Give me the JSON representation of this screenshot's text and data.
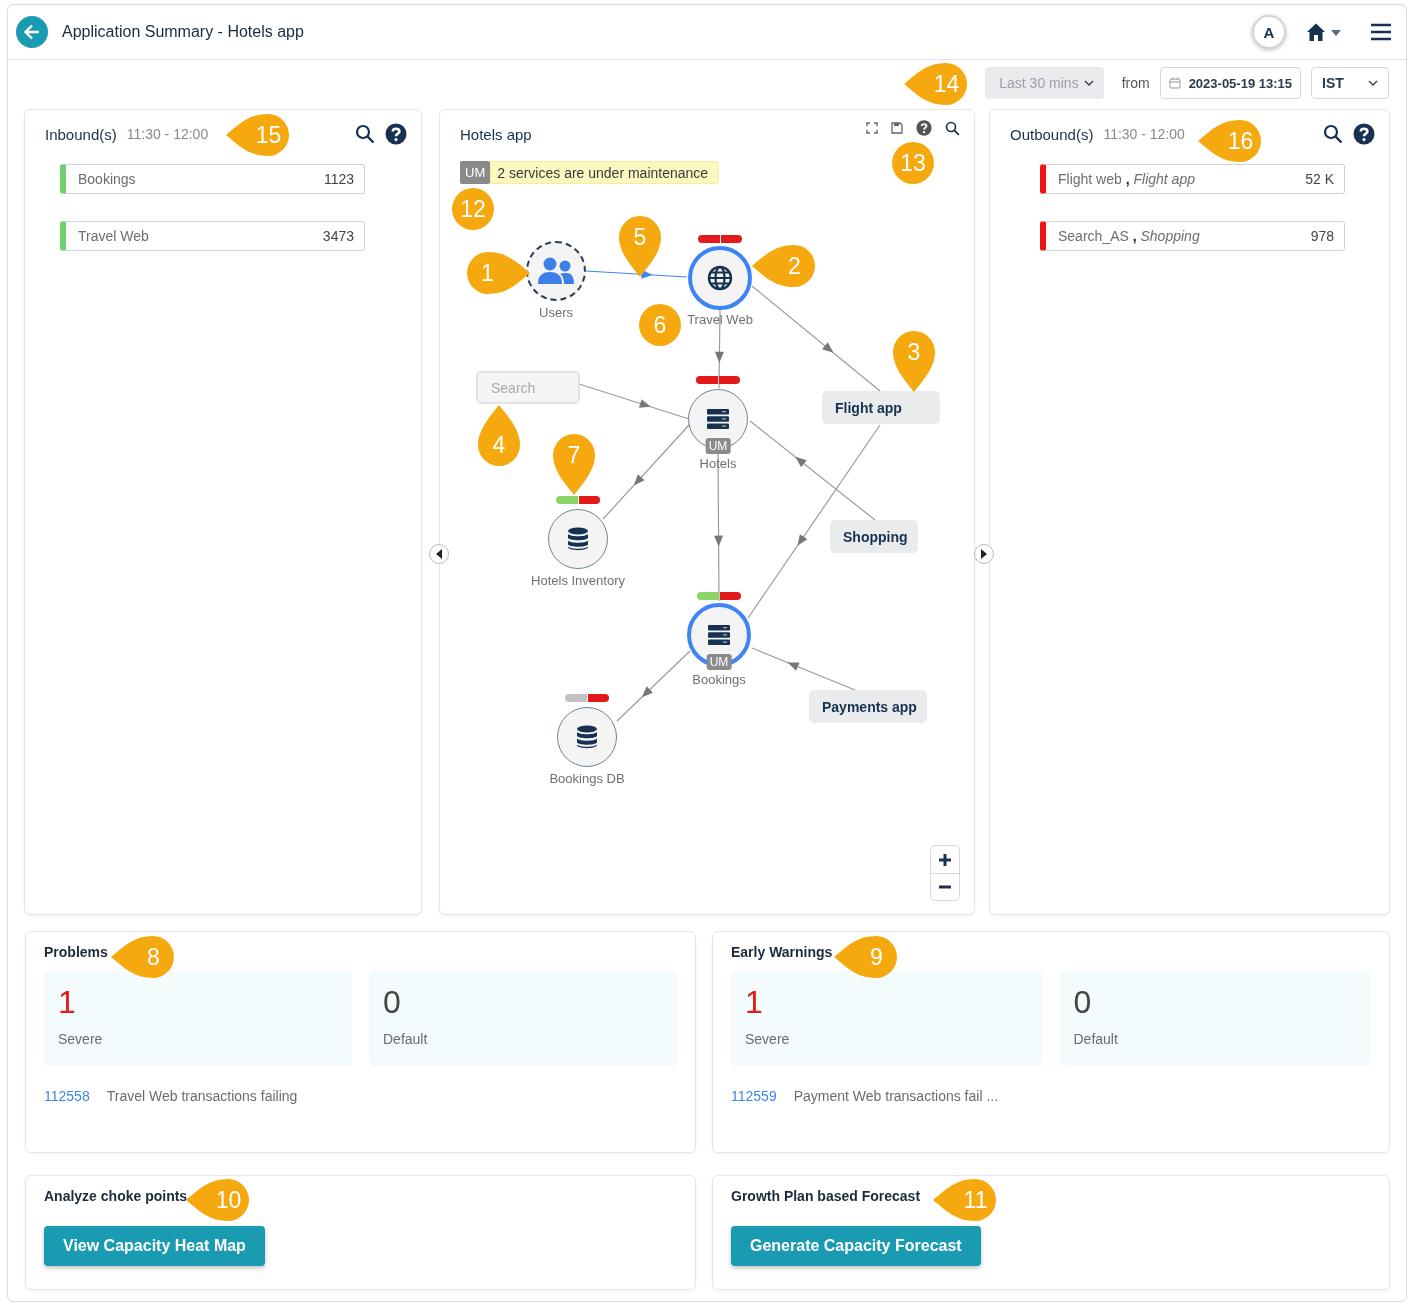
{
  "header": {
    "title": "Application Summary - Hotels app",
    "avatar": "A"
  },
  "toolbar": {
    "range": {
      "value": "Last 30 mins",
      "disabled": true
    },
    "from_label": "from",
    "date": "2023-05-19 13:15",
    "timezone": "IST"
  },
  "inbound": {
    "title": "Inbound(s)",
    "time": "11:30 - 12:00",
    "items": [
      {
        "text": "Bookings",
        "value": "1123",
        "color": "#6fd06f"
      },
      {
        "text": "Travel Web",
        "value": "3473",
        "color": "#6fd06f"
      }
    ]
  },
  "graph": {
    "title": "Hotels app",
    "banner": {
      "badge": "UM",
      "text": "2 services are under maintenance"
    },
    "nodes": [
      {
        "kind": "user",
        "label": "Users",
        "highlighted": false
      },
      {
        "kind": "web",
        "label": "Travel Web",
        "highlighted": true,
        "status": [
          {
            "color": "#e3191b"
          },
          {
            "color": "#e3191b"
          }
        ]
      },
      {
        "kind": "external",
        "label": "Search",
        "disabled": true
      },
      {
        "kind": "service",
        "label": "Hotels",
        "highlighted": false,
        "badge": "UM",
        "status": [
          {
            "color": "#e3191b"
          },
          {
            "color": "#e3191b"
          }
        ]
      },
      {
        "kind": "external",
        "label": "Flight app",
        "disabled": false
      },
      {
        "kind": "database",
        "label": "Hotels Inventory",
        "highlighted": false,
        "status": [
          {
            "color": "#8ad46a"
          },
          {
            "color": "#e3191b"
          }
        ]
      },
      {
        "kind": "external",
        "label": "Shopping",
        "disabled": false
      },
      {
        "kind": "service",
        "label": "Bookings",
        "highlighted": true,
        "badge": "UM",
        "status": [
          {
            "color": "#8ad46a"
          },
          {
            "color": "#e3191b"
          }
        ]
      },
      {
        "kind": "external",
        "label": "Payments app",
        "disabled": false
      },
      {
        "kind": "database",
        "label": "Bookings DB",
        "highlighted": false,
        "status": [
          {
            "color": "#c2c2c2"
          },
          {
            "color": "#e3191b"
          }
        ]
      }
    ]
  },
  "outbound": {
    "title": "Outbound(s)",
    "time": "11:30 - 12:00",
    "items": [
      {
        "text": "Flight web **,** *Flight app*",
        "value": "52 K",
        "color": "#f01414"
      },
      {
        "text": "Search_AS **,** *Shopping*",
        "value": "978",
        "color": "#f01414"
      }
    ]
  },
  "problems": {
    "title": "Problems",
    "tiles": [
      {
        "kind": "severe",
        "count": "1",
        "label": "Severe"
      },
      {
        "kind": "default",
        "count": "0",
        "label": "Default"
      }
    ],
    "entries": [
      {
        "id": "112558",
        "text": "Travel Web transactions failing"
      }
    ]
  },
  "early_warnings": {
    "title": "Early Warnings",
    "tiles": [
      {
        "kind": "severe",
        "count": "1",
        "label": "Severe"
      },
      {
        "kind": "default",
        "count": "0",
        "label": "Default"
      }
    ],
    "entries": [
      {
        "id": "112559",
        "text": "Payment Web transactions fail ..."
      }
    ]
  },
  "choke_points": {
    "title": "Analyze choke points",
    "button": "View Capacity Heat Map"
  },
  "forecast": {
    "title": "Growth Plan based Forecast",
    "button": "Generate Capacity Forecast"
  },
  "callouts": [
    {
      "number": "1",
      "kind": "right"
    },
    {
      "number": "2",
      "kind": "left"
    },
    {
      "number": "3",
      "kind": "down"
    },
    {
      "number": "4",
      "kind": "up"
    },
    {
      "number": "5",
      "kind": "down"
    },
    {
      "number": "6",
      "kind": "round"
    },
    {
      "number": "7",
      "kind": "down"
    },
    {
      "number": "8",
      "kind": "left"
    },
    {
      "number": "9",
      "kind": "left"
    },
    {
      "number": "10",
      "kind": "left"
    },
    {
      "number": "11",
      "kind": "left"
    },
    {
      "number": "12",
      "kind": "round"
    },
    {
      "number": "13",
      "kind": "round"
    },
    {
      "number": "14",
      "kind": "left"
    },
    {
      "number": "15",
      "kind": "left"
    },
    {
      "number": "16",
      "kind": "left"
    }
  ]
}
